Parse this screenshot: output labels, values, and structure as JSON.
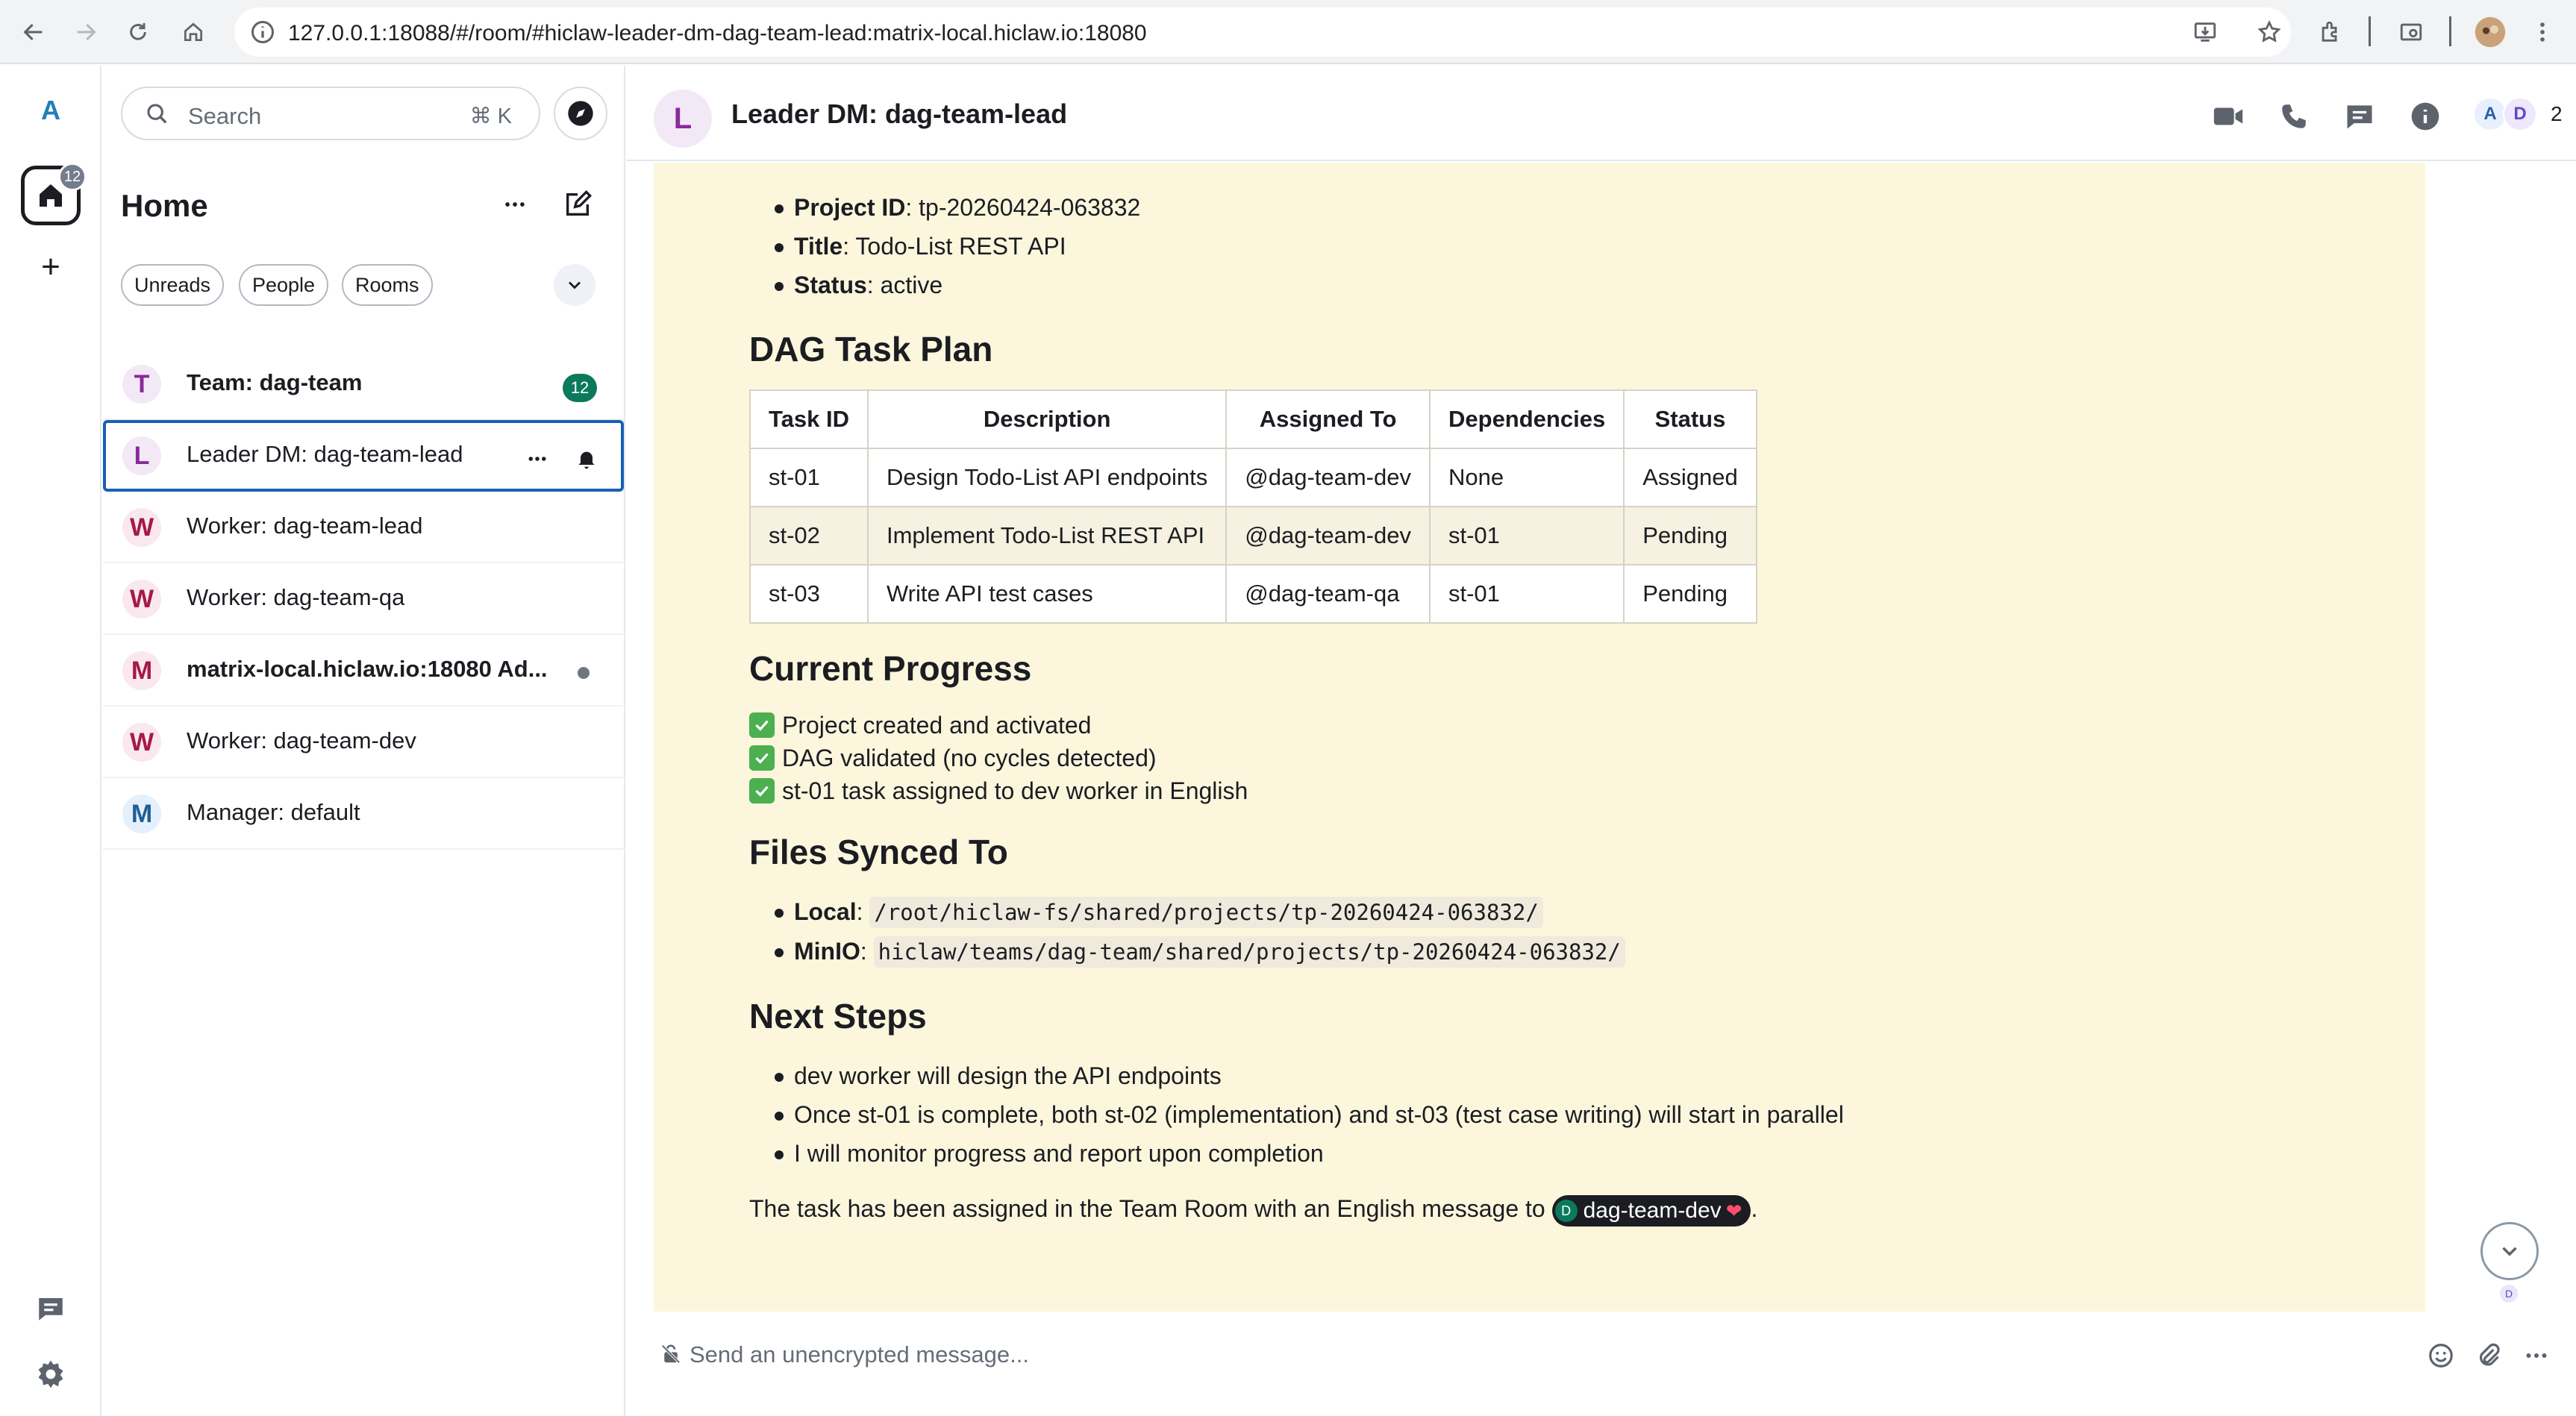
{
  "browser": {
    "url": "127.0.0.1:18088/#/room/#hiclaw-leader-dm-dag-team-lead:matrix-local.hiclaw.io:18080"
  },
  "spacebar": {
    "user_initial": "A",
    "home_badge": "12",
    "add_label": "+"
  },
  "roomlist": {
    "search_placeholder": "Search",
    "search_shortcut": "⌘ K",
    "title": "Home",
    "filters": [
      "Unreads",
      "People",
      "Rooms"
    ],
    "rooms": [
      {
        "initial": "T",
        "name": "Team: dag-team",
        "bold": true,
        "badge": "12",
        "avatar_bg": "#f3e9f6",
        "avatar_fg": "#8a2a9c"
      },
      {
        "initial": "L",
        "name": "Leader DM: dag-team-lead",
        "bold": false,
        "selected": true,
        "avatar_bg": "#f3e9f6",
        "avatar_fg": "#8a2a9c"
      },
      {
        "initial": "W",
        "name": "Worker: dag-team-lead",
        "bold": false,
        "avatar_bg": "#fbe7ee",
        "avatar_fg": "#a4194a"
      },
      {
        "initial": "W",
        "name": "Worker: dag-team-qa",
        "bold": false,
        "avatar_bg": "#fbe7ee",
        "avatar_fg": "#a4194a"
      },
      {
        "initial": "M",
        "name": "matrix-local.hiclaw.io:18080 Ad...",
        "bold": true,
        "dot": true,
        "avatar_bg": "#fbe7ee",
        "avatar_fg": "#a4194a"
      },
      {
        "initial": "W",
        "name": "Worker: dag-team-dev",
        "bold": false,
        "avatar_bg": "#fbe7ee",
        "avatar_fg": "#a4194a"
      },
      {
        "initial": "M",
        "name": "Manager: default",
        "bold": false,
        "avatar_bg": "#e4f0fb",
        "avatar_fg": "#1f5f96"
      }
    ]
  },
  "room": {
    "initial": "L",
    "title": "Leader DM: dag-team-lead",
    "member_initials": [
      "A",
      "D"
    ],
    "member_count": "2"
  },
  "message": {
    "project": [
      {
        "label": "Project ID",
        "value": ": tp-20260424-063832"
      },
      {
        "label": "Title",
        "value": ": Todo-List REST API"
      },
      {
        "label": "Status",
        "value": ": active"
      }
    ],
    "dag_heading": "DAG Task Plan",
    "table_headers": [
      "Task ID",
      "Description",
      "Assigned To",
      "Dependencies",
      "Status"
    ],
    "table_rows": [
      [
        "st-01",
        "Design Todo-List API endpoints",
        "@dag-team-dev",
        "None",
        "Assigned"
      ],
      [
        "st-02",
        "Implement Todo-List REST API",
        "@dag-team-dev",
        "st-01",
        "Pending"
      ],
      [
        "st-03",
        "Write API test cases",
        "@dag-team-qa",
        "st-01",
        "Pending"
      ]
    ],
    "progress_heading": "Current Progress",
    "progress_items": [
      "Project created and activated",
      "DAG validated (no cycles detected)",
      "st-01 task assigned to dev worker in English"
    ],
    "files_heading": "Files Synced To",
    "files": [
      {
        "label": "Local",
        "sep": ": ",
        "path": "/root/hiclaw-fs/shared/projects/tp-20260424-063832/"
      },
      {
        "label": "MinIO",
        "sep": ": ",
        "path": "hiclaw/teams/dag-team/shared/projects/tp-20260424-063832/"
      }
    ],
    "next_heading": "Next Steps",
    "next_steps": [
      "dev worker will design the API endpoints",
      "Once st-01 is complete, both st-02 (implementation) and st-03 (test case writing) will start in parallel",
      "I will monitor progress and report upon completion"
    ],
    "closing_text": "The task has been assigned in the Team Room with an English message to ",
    "mention_initial": "D",
    "mention_name": "dag-team-dev",
    "mention_heart": "❤",
    "closing_end": "."
  },
  "receipt_initial": "D",
  "composer": {
    "placeholder": "Send an unencrypted message..."
  }
}
